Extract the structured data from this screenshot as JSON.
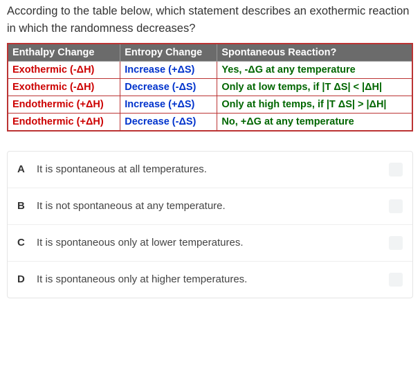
{
  "question": "According to the table below, which statement describes an exothermic reaction in which the randomness decreases?",
  "table": {
    "headers": [
      "Enthalpy Change",
      "Entropy Change",
      "Spontaneous Reaction?"
    ],
    "rows": [
      {
        "enthalpy": "Exothermic (-ΔH)",
        "entropy": "Increase (+ΔS)",
        "spont": "Yes, -ΔG at any temperature",
        "colors": [
          "c-red",
          "c-blue",
          "c-green"
        ]
      },
      {
        "enthalpy": "Exothermic (-ΔH)",
        "entropy": "Decrease (-ΔS)",
        "spont": "Only at low temps, if |T ΔS| < |ΔH|",
        "colors": [
          "c-red",
          "c-blue",
          "c-green"
        ]
      },
      {
        "enthalpy": "Endothermic (+ΔH)",
        "entropy": "Increase (+ΔS)",
        "spont": "Only at high temps, if |T ΔS| > |ΔH|",
        "colors": [
          "c-red",
          "c-blue",
          "c-green"
        ]
      },
      {
        "enthalpy": "Endothermic (+ΔH)",
        "entropy": "Decrease (-ΔS)",
        "spont": "No, +ΔG at any temperature",
        "colors": [
          "c-red",
          "c-blue",
          "c-green"
        ]
      }
    ]
  },
  "options": [
    {
      "letter": "A",
      "text": "It is spontaneous at all temperatures."
    },
    {
      "letter": "B",
      "text": "It is not spontaneous at any temperature."
    },
    {
      "letter": "C",
      "text": "It is spontaneous only at lower temperatures."
    },
    {
      "letter": "D",
      "text": "It is spontaneous only at higher temperatures."
    }
  ]
}
